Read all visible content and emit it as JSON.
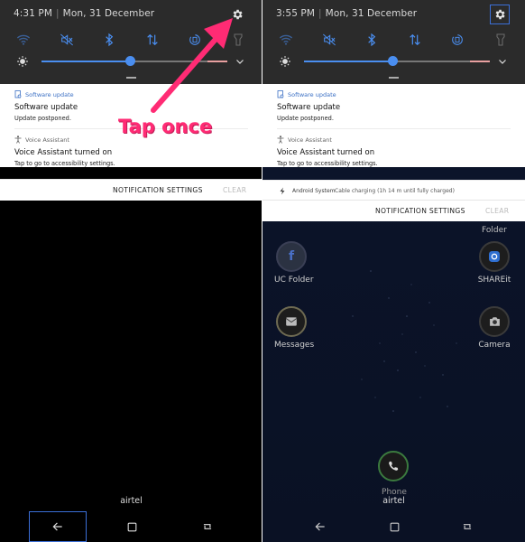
{
  "left": {
    "status": {
      "time": "4:31 PM",
      "separator": "|",
      "date": "Mon, 31 December"
    },
    "notifications": [
      {
        "app": "Software update",
        "title": "Software update",
        "body": "Update postponed."
      },
      {
        "app": "Voice Assistant",
        "title": "Voice Assistant turned on",
        "body": "Tap to go to accessibility settings."
      }
    ],
    "notification_settings": "NOTIFICATION SETTINGS",
    "clear": "CLEAR",
    "annotation": "Tap once",
    "carrier": "airtel"
  },
  "right": {
    "status": {
      "time": "3:55 PM",
      "separator": "|",
      "date": "Mon, 31 December"
    },
    "notifications": [
      {
        "app": "Software update",
        "title": "Software update",
        "body": "Update postponed."
      },
      {
        "app": "Voice Assistant",
        "title": "Voice Assistant turned on",
        "body": "Tap to go to accessibility settings."
      }
    ],
    "system_row": {
      "app": "Android System",
      "text": "Cable charging (1h 14 m until fully charged)"
    },
    "notification_settings": "NOTIFICATION SETTINGS",
    "clear": "CLEAR",
    "home_apps": {
      "folder_top": "Folder",
      "uc_folder": "UC Folder",
      "shareit": "SHAREit",
      "messages": "Messages",
      "camera": "Camera",
      "phone": "Phone"
    },
    "carrier": "airtel"
  },
  "brightness": {
    "left": 0.48,
    "right": 0.48
  },
  "colors": {
    "accent": "#4a8ef0",
    "annotation": "#ff2b74",
    "focus": "#3b6fd8"
  },
  "icons": [
    "gear-icon",
    "wifi-icon",
    "sound-off-icon",
    "bluetooth-icon",
    "data-transfer-icon",
    "rotate-icon",
    "flashlight-icon",
    "brightness-icon",
    "chevron-down-icon",
    "back-icon",
    "home-icon",
    "recents-icon"
  ]
}
